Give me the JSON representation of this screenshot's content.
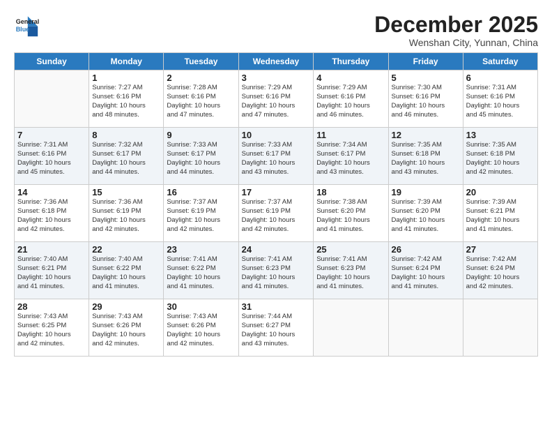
{
  "logo": {
    "line1": "General",
    "line2": "Blue"
  },
  "title": "December 2025",
  "subtitle": "Wenshan City, Yunnan, China",
  "days_of_week": [
    "Sunday",
    "Monday",
    "Tuesday",
    "Wednesday",
    "Thursday",
    "Friday",
    "Saturday"
  ],
  "weeks": [
    [
      {
        "day": "",
        "info": ""
      },
      {
        "day": "1",
        "info": "Sunrise: 7:27 AM\nSunset: 6:16 PM\nDaylight: 10 hours\nand 48 minutes."
      },
      {
        "day": "2",
        "info": "Sunrise: 7:28 AM\nSunset: 6:16 PM\nDaylight: 10 hours\nand 47 minutes."
      },
      {
        "day": "3",
        "info": "Sunrise: 7:29 AM\nSunset: 6:16 PM\nDaylight: 10 hours\nand 47 minutes."
      },
      {
        "day": "4",
        "info": "Sunrise: 7:29 AM\nSunset: 6:16 PM\nDaylight: 10 hours\nand 46 minutes."
      },
      {
        "day": "5",
        "info": "Sunrise: 7:30 AM\nSunset: 6:16 PM\nDaylight: 10 hours\nand 46 minutes."
      },
      {
        "day": "6",
        "info": "Sunrise: 7:31 AM\nSunset: 6:16 PM\nDaylight: 10 hours\nand 45 minutes."
      }
    ],
    [
      {
        "day": "7",
        "info": "Sunrise: 7:31 AM\nSunset: 6:16 PM\nDaylight: 10 hours\nand 45 minutes."
      },
      {
        "day": "8",
        "info": "Sunrise: 7:32 AM\nSunset: 6:17 PM\nDaylight: 10 hours\nand 44 minutes."
      },
      {
        "day": "9",
        "info": "Sunrise: 7:33 AM\nSunset: 6:17 PM\nDaylight: 10 hours\nand 44 minutes."
      },
      {
        "day": "10",
        "info": "Sunrise: 7:33 AM\nSunset: 6:17 PM\nDaylight: 10 hours\nand 43 minutes."
      },
      {
        "day": "11",
        "info": "Sunrise: 7:34 AM\nSunset: 6:17 PM\nDaylight: 10 hours\nand 43 minutes."
      },
      {
        "day": "12",
        "info": "Sunrise: 7:35 AM\nSunset: 6:18 PM\nDaylight: 10 hours\nand 43 minutes."
      },
      {
        "day": "13",
        "info": "Sunrise: 7:35 AM\nSunset: 6:18 PM\nDaylight: 10 hours\nand 42 minutes."
      }
    ],
    [
      {
        "day": "14",
        "info": "Sunrise: 7:36 AM\nSunset: 6:18 PM\nDaylight: 10 hours\nand 42 minutes."
      },
      {
        "day": "15",
        "info": "Sunrise: 7:36 AM\nSunset: 6:19 PM\nDaylight: 10 hours\nand 42 minutes."
      },
      {
        "day": "16",
        "info": "Sunrise: 7:37 AM\nSunset: 6:19 PM\nDaylight: 10 hours\nand 42 minutes."
      },
      {
        "day": "17",
        "info": "Sunrise: 7:37 AM\nSunset: 6:19 PM\nDaylight: 10 hours\nand 42 minutes."
      },
      {
        "day": "18",
        "info": "Sunrise: 7:38 AM\nSunset: 6:20 PM\nDaylight: 10 hours\nand 41 minutes."
      },
      {
        "day": "19",
        "info": "Sunrise: 7:39 AM\nSunset: 6:20 PM\nDaylight: 10 hours\nand 41 minutes."
      },
      {
        "day": "20",
        "info": "Sunrise: 7:39 AM\nSunset: 6:21 PM\nDaylight: 10 hours\nand 41 minutes."
      }
    ],
    [
      {
        "day": "21",
        "info": "Sunrise: 7:40 AM\nSunset: 6:21 PM\nDaylight: 10 hours\nand 41 minutes."
      },
      {
        "day": "22",
        "info": "Sunrise: 7:40 AM\nSunset: 6:22 PM\nDaylight: 10 hours\nand 41 minutes."
      },
      {
        "day": "23",
        "info": "Sunrise: 7:41 AM\nSunset: 6:22 PM\nDaylight: 10 hours\nand 41 minutes."
      },
      {
        "day": "24",
        "info": "Sunrise: 7:41 AM\nSunset: 6:23 PM\nDaylight: 10 hours\nand 41 minutes."
      },
      {
        "day": "25",
        "info": "Sunrise: 7:41 AM\nSunset: 6:23 PM\nDaylight: 10 hours\nand 41 minutes."
      },
      {
        "day": "26",
        "info": "Sunrise: 7:42 AM\nSunset: 6:24 PM\nDaylight: 10 hours\nand 41 minutes."
      },
      {
        "day": "27",
        "info": "Sunrise: 7:42 AM\nSunset: 6:24 PM\nDaylight: 10 hours\nand 42 minutes."
      }
    ],
    [
      {
        "day": "28",
        "info": "Sunrise: 7:43 AM\nSunset: 6:25 PM\nDaylight: 10 hours\nand 42 minutes."
      },
      {
        "day": "29",
        "info": "Sunrise: 7:43 AM\nSunset: 6:26 PM\nDaylight: 10 hours\nand 42 minutes."
      },
      {
        "day": "30",
        "info": "Sunrise: 7:43 AM\nSunset: 6:26 PM\nDaylight: 10 hours\nand 42 minutes."
      },
      {
        "day": "31",
        "info": "Sunrise: 7:44 AM\nSunset: 6:27 PM\nDaylight: 10 hours\nand 43 minutes."
      },
      {
        "day": "",
        "info": ""
      },
      {
        "day": "",
        "info": ""
      },
      {
        "day": "",
        "info": ""
      }
    ]
  ]
}
